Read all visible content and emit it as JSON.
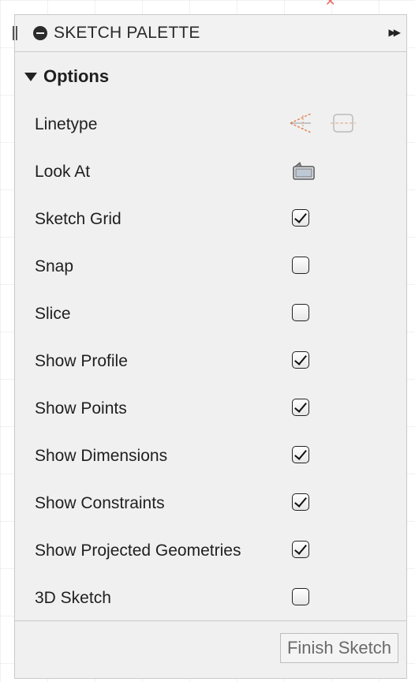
{
  "palette": {
    "title": "SKETCH PALETTE"
  },
  "options": {
    "section_title": "Options",
    "rows": [
      {
        "label": "Linetype",
        "control": "linetype"
      },
      {
        "label": "Look At",
        "control": "look-at"
      },
      {
        "label": "Sketch Grid",
        "control": "checkbox",
        "checked": true
      },
      {
        "label": "Snap",
        "control": "checkbox",
        "checked": false
      },
      {
        "label": "Slice",
        "control": "checkbox",
        "checked": false
      },
      {
        "label": "Show Profile",
        "control": "checkbox",
        "checked": true
      },
      {
        "label": "Show Points",
        "control": "checkbox",
        "checked": true
      },
      {
        "label": "Show Dimensions",
        "control": "checkbox",
        "checked": true
      },
      {
        "label": "Show Constraints",
        "control": "checkbox",
        "checked": true
      },
      {
        "label": "Show Projected Geometries",
        "control": "checkbox",
        "checked": true
      },
      {
        "label": "3D Sketch",
        "control": "checkbox",
        "checked": false
      }
    ]
  },
  "footer": {
    "finish_label": "Finish Sketch"
  },
  "colors": {
    "panel_bg": "#f0f0f0",
    "border": "#c9c9c9",
    "construction_line": "#e08a5a",
    "disabled_text": "#6a6a6a"
  },
  "icons": {
    "collapse": "minus-circle-icon",
    "expand_panel": "fast-forward-icon",
    "section_toggle": "triangle-down-icon",
    "construction": "construction-line-icon",
    "centerline": "centerline-icon",
    "look_at": "look-at-icon"
  }
}
